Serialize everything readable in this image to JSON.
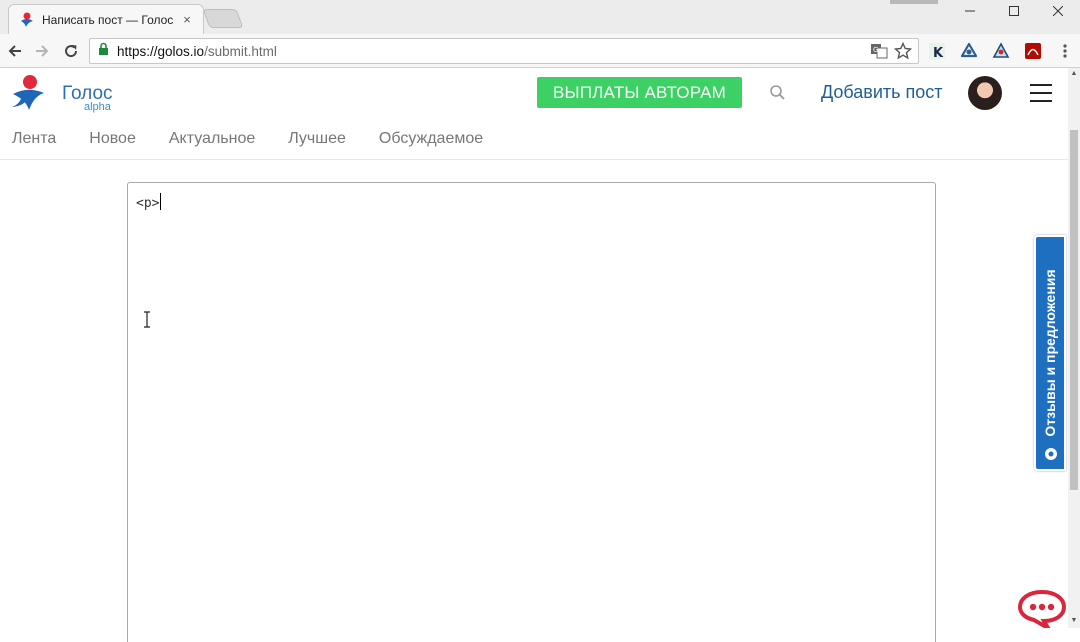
{
  "browser": {
    "tab_title": "Написать пост — Голос",
    "tab_close": "×",
    "url_host": "https://golos.io",
    "url_path": "/submit.html"
  },
  "header": {
    "brand": "Голос",
    "brand_sub": "alpha",
    "payout_button": "ВЫПЛАТЫ АВТОРАМ",
    "add_post": "Добавить пост"
  },
  "nav": {
    "items": [
      "Лента",
      "Новое",
      "Актуальное",
      "Лучшее",
      "Обсуждаемое"
    ]
  },
  "editor": {
    "content": "<p>"
  },
  "feedback": {
    "label": "Отзывы и предложения"
  },
  "colors": {
    "brand_blue": "#2e6fb0",
    "payout_green": "#3dd065",
    "feedback_blue": "#1e6fc0",
    "chat_red": "#d9263b"
  },
  "icons": {
    "back": "arrow-left-icon",
    "forward": "arrow-right-icon",
    "reload": "reload-icon",
    "lock": "lock-icon",
    "translate": "translate-icon",
    "star": "star-icon",
    "search": "search-icon",
    "menu": "hamburger-icon",
    "chat": "chat-bubble-icon"
  }
}
